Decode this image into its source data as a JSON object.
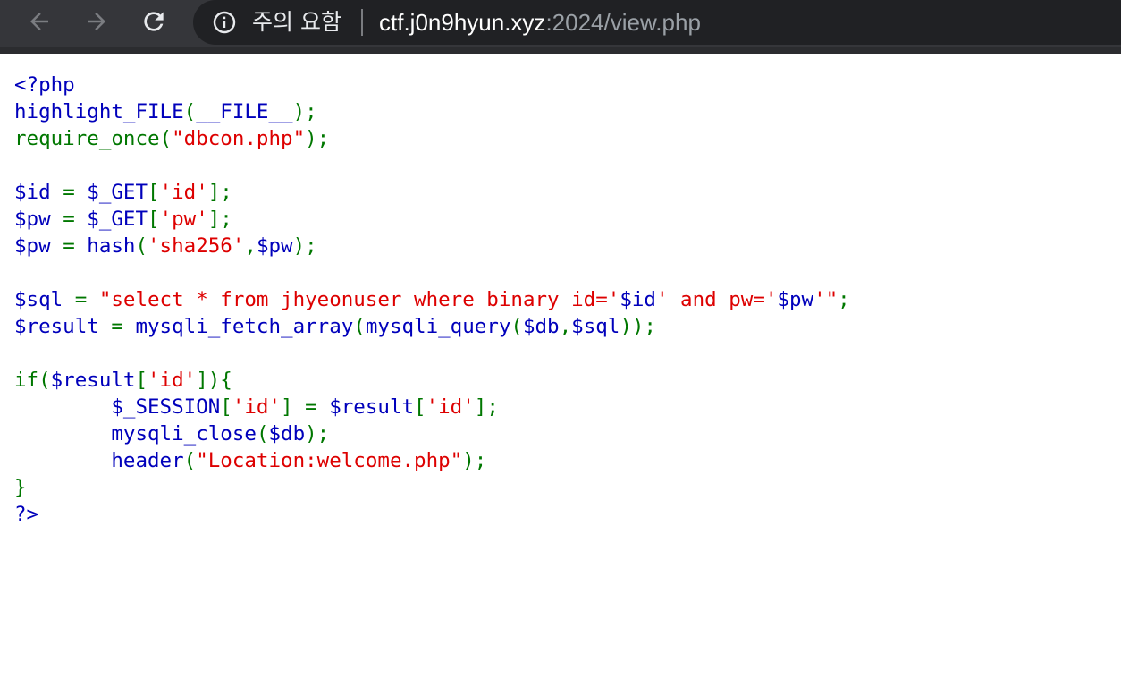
{
  "browser": {
    "back_icon": "arrow-left-icon",
    "forward_icon": "arrow-right-icon",
    "reload_icon": "reload-icon",
    "info_icon": "info-icon",
    "security_label": "주의 요함",
    "url_host": "ctf.j0n9hyun.xyz",
    "url_rest": ":2024/view.php"
  },
  "colors": {
    "default": "#0000BB",
    "keyword": "#007700",
    "string": "#DD0000",
    "toolbar": "#35363a",
    "omnibox": "#202124"
  },
  "code": {
    "lines": [
      [
        {
          "t": "d",
          "v": "<?php"
        }
      ],
      [
        {
          "t": "d",
          "v": "highlight_FILE"
        },
        {
          "t": "k",
          "v": "("
        },
        {
          "t": "d",
          "v": "__FILE__"
        },
        {
          "t": "k",
          "v": ");"
        }
      ],
      [
        {
          "t": "k",
          "v": "require_once("
        },
        {
          "t": "s",
          "v": "\"dbcon.php\""
        },
        {
          "t": "k",
          "v": ");"
        }
      ],
      [],
      [
        {
          "t": "d",
          "v": "$id "
        },
        {
          "t": "k",
          "v": "= "
        },
        {
          "t": "d",
          "v": "$_GET"
        },
        {
          "t": "k",
          "v": "["
        },
        {
          "t": "s",
          "v": "'id'"
        },
        {
          "t": "k",
          "v": "];"
        }
      ],
      [
        {
          "t": "d",
          "v": "$pw "
        },
        {
          "t": "k",
          "v": "= "
        },
        {
          "t": "d",
          "v": "$_GET"
        },
        {
          "t": "k",
          "v": "["
        },
        {
          "t": "s",
          "v": "'pw'"
        },
        {
          "t": "k",
          "v": "];"
        }
      ],
      [
        {
          "t": "d",
          "v": "$pw "
        },
        {
          "t": "k",
          "v": "= "
        },
        {
          "t": "d",
          "v": "hash"
        },
        {
          "t": "k",
          "v": "("
        },
        {
          "t": "s",
          "v": "'sha256'"
        },
        {
          "t": "k",
          "v": ","
        },
        {
          "t": "d",
          "v": "$pw"
        },
        {
          "t": "k",
          "v": ");"
        }
      ],
      [],
      [
        {
          "t": "d",
          "v": "$sql "
        },
        {
          "t": "k",
          "v": "= "
        },
        {
          "t": "s",
          "v": "\"select * from jhyeonuser where binary id='"
        },
        {
          "t": "d",
          "v": "$id"
        },
        {
          "t": "s",
          "v": "' and pw='"
        },
        {
          "t": "d",
          "v": "$pw"
        },
        {
          "t": "s",
          "v": "'\""
        },
        {
          "t": "k",
          "v": ";"
        }
      ],
      [
        {
          "t": "d",
          "v": "$result "
        },
        {
          "t": "k",
          "v": "= "
        },
        {
          "t": "d",
          "v": "mysqli_fetch_array"
        },
        {
          "t": "k",
          "v": "("
        },
        {
          "t": "d",
          "v": "mysqli_query"
        },
        {
          "t": "k",
          "v": "("
        },
        {
          "t": "d",
          "v": "$db"
        },
        {
          "t": "k",
          "v": ","
        },
        {
          "t": "d",
          "v": "$sql"
        },
        {
          "t": "k",
          "v": "));"
        }
      ],
      [],
      [
        {
          "t": "k",
          "v": "if("
        },
        {
          "t": "d",
          "v": "$result"
        },
        {
          "t": "k",
          "v": "["
        },
        {
          "t": "s",
          "v": "'id'"
        },
        {
          "t": "k",
          "v": "]){"
        }
      ],
      [
        {
          "t": "d",
          "v": "        $_SESSION"
        },
        {
          "t": "k",
          "v": "["
        },
        {
          "t": "s",
          "v": "'id'"
        },
        {
          "t": "k",
          "v": "] = "
        },
        {
          "t": "d",
          "v": "$result"
        },
        {
          "t": "k",
          "v": "["
        },
        {
          "t": "s",
          "v": "'id'"
        },
        {
          "t": "k",
          "v": "];"
        }
      ],
      [
        {
          "t": "d",
          "v": "        mysqli_close"
        },
        {
          "t": "k",
          "v": "("
        },
        {
          "t": "d",
          "v": "$db"
        },
        {
          "t": "k",
          "v": ");"
        }
      ],
      [
        {
          "t": "d",
          "v": "        header"
        },
        {
          "t": "k",
          "v": "("
        },
        {
          "t": "s",
          "v": "\"Location:welcome.php\""
        },
        {
          "t": "k",
          "v": ");"
        }
      ],
      [
        {
          "t": "k",
          "v": "}"
        }
      ],
      [
        {
          "t": "d",
          "v": "?>"
        }
      ]
    ]
  }
}
